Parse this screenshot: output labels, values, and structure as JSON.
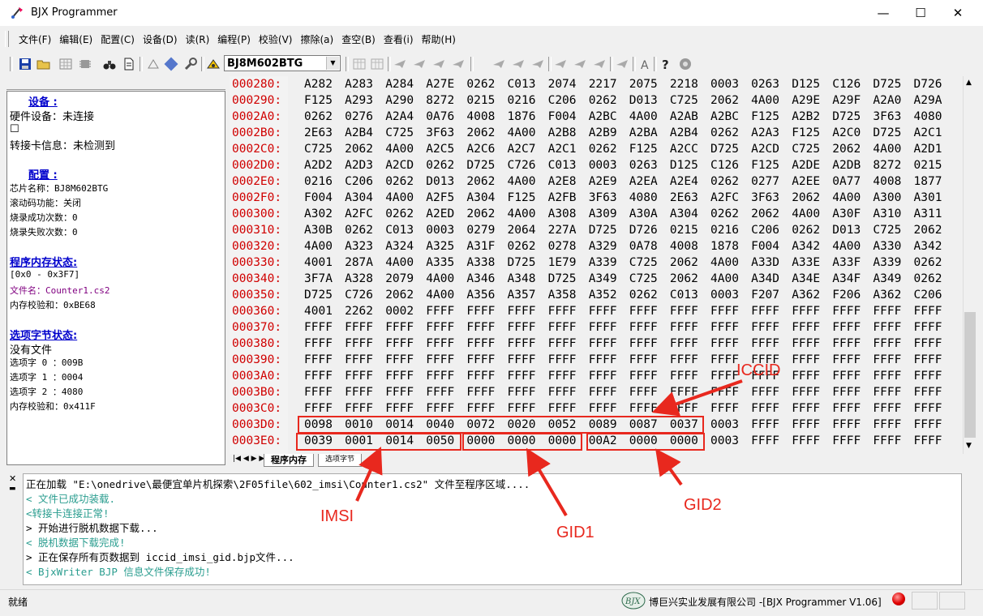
{
  "window": {
    "title": "BJX Programmer",
    "controls": {
      "minimize": "—",
      "maximize": "☐",
      "close": "✕"
    }
  },
  "menu": {
    "items": [
      "文件(F)",
      "编辑(E)",
      "配置(C)",
      "设备(D)",
      "读(R)",
      "编程(P)",
      "校验(V)",
      "擦除(a)",
      "查空(B)",
      "查看(i)",
      "帮助(H)"
    ]
  },
  "toolbar": {
    "chip_select": "BJ8M602BTG"
  },
  "left_panel": {
    "device_heading": "设备  :",
    "hardware_device": "硬件设备：未连接",
    "adapter_info": "转接卡信息：未检测到",
    "config_heading": "配置  :",
    "chip_name": "芯片名称：BJ8M602BTG",
    "rolling_code": "滚动码功能：关闭",
    "burn_success": "烧录成功次数：0",
    "burn_fail": "烧录失败次数：0",
    "memory_heading": "程序内存状态:",
    "memory_range": "[0x0 - 0x3F7]",
    "file_name_label": "文件名：",
    "file_name": "Counter1.cs2",
    "memory_checksum": "内存校验和：0xBE68",
    "option_heading": "选项字节状态:",
    "no_file": "没有文件",
    "option0": "选项字 0 ：009B",
    "option1": "选项字 1 ：0004",
    "option2": "选项字 2 ：4080",
    "option_checksum": "内存校验和：0x411F"
  },
  "hex": {
    "rows": [
      {
        "addr": "000280:",
        "words": [
          "A282",
          "A283",
          "A284",
          "A27E",
          "0262",
          "C013",
          "2074",
          "2217",
          "2075",
          "2218",
          "0003",
          "0263",
          "D125",
          "C126",
          "D725",
          "D726"
        ]
      },
      {
        "addr": "000290:",
        "words": [
          "F125",
          "A293",
          "A290",
          "8272",
          "0215",
          "0216",
          "C206",
          "0262",
          "D013",
          "C725",
          "2062",
          "4A00",
          "A29E",
          "A29F",
          "A2A0",
          "A29A"
        ]
      },
      {
        "addr": "0002A0:",
        "words": [
          "0262",
          "0276",
          "A2A4",
          "0A76",
          "4008",
          "1876",
          "F004",
          "A2BC",
          "4A00",
          "A2AB",
          "A2BC",
          "F125",
          "A2B2",
          "D725",
          "3F63",
          "4080"
        ]
      },
      {
        "addr": "0002B0:",
        "words": [
          "2E63",
          "A2B4",
          "C725",
          "3F63",
          "2062",
          "4A00",
          "A2B8",
          "A2B9",
          "A2BA",
          "A2B4",
          "0262",
          "A2A3",
          "F125",
          "A2C0",
          "D725",
          "A2C1"
        ]
      },
      {
        "addr": "0002C0:",
        "words": [
          "C725",
          "2062",
          "4A00",
          "A2C5",
          "A2C6",
          "A2C7",
          "A2C1",
          "0262",
          "F125",
          "A2CC",
          "D725",
          "A2CD",
          "C725",
          "2062",
          "4A00",
          "A2D1"
        ]
      },
      {
        "addr": "0002D0:",
        "words": [
          "A2D2",
          "A2D3",
          "A2CD",
          "0262",
          "D725",
          "C726",
          "C013",
          "0003",
          "0263",
          "D125",
          "C126",
          "F125",
          "A2DE",
          "A2DB",
          "8272",
          "0215"
        ]
      },
      {
        "addr": "0002E0:",
        "words": [
          "0216",
          "C206",
          "0262",
          "D013",
          "2062",
          "4A00",
          "A2E8",
          "A2E9",
          "A2EA",
          "A2E4",
          "0262",
          "0277",
          "A2EE",
          "0A77",
          "4008",
          "1877"
        ]
      },
      {
        "addr": "0002F0:",
        "words": [
          "F004",
          "A304",
          "4A00",
          "A2F5",
          "A304",
          "F125",
          "A2FB",
          "3F63",
          "4080",
          "2E63",
          "A2FC",
          "3F63",
          "2062",
          "4A00",
          "A300",
          "A301"
        ]
      },
      {
        "addr": "000300:",
        "words": [
          "A302",
          "A2FC",
          "0262",
          "A2ED",
          "2062",
          "4A00",
          "A308",
          "A309",
          "A30A",
          "A304",
          "0262",
          "2062",
          "4A00",
          "A30F",
          "A310",
          "A311"
        ]
      },
      {
        "addr": "000310:",
        "words": [
          "A30B",
          "0262",
          "C013",
          "0003",
          "0279",
          "2064",
          "227A",
          "D725",
          "D726",
          "0215",
          "0216",
          "C206",
          "0262",
          "D013",
          "C725",
          "2062"
        ]
      },
      {
        "addr": "000320:",
        "words": [
          "4A00",
          "A323",
          "A324",
          "A325",
          "A31F",
          "0262",
          "0278",
          "A329",
          "0A78",
          "4008",
          "1878",
          "F004",
          "A342",
          "4A00",
          "A330",
          "A342"
        ]
      },
      {
        "addr": "000330:",
        "words": [
          "4001",
          "287A",
          "4A00",
          "A335",
          "A338",
          "D725",
          "1E79",
          "A339",
          "C725",
          "2062",
          "4A00",
          "A33D",
          "A33E",
          "A33F",
          "A339",
          "0262"
        ]
      },
      {
        "addr": "000340:",
        "words": [
          "3F7A",
          "A328",
          "2079",
          "4A00",
          "A346",
          "A348",
          "D725",
          "A349",
          "C725",
          "2062",
          "4A00",
          "A34D",
          "A34E",
          "A34F",
          "A349",
          "0262"
        ]
      },
      {
        "addr": "000350:",
        "words": [
          "D725",
          "C726",
          "2062",
          "4A00",
          "A356",
          "A357",
          "A358",
          "A352",
          "0262",
          "C013",
          "0003",
          "F207",
          "A362",
          "F206",
          "A362",
          "C206"
        ]
      },
      {
        "addr": "000360:",
        "words": [
          "4001",
          "2262",
          "0002",
          "FFFF",
          "FFFF",
          "FFFF",
          "FFFF",
          "FFFF",
          "FFFF",
          "FFFF",
          "FFFF",
          "FFFF",
          "FFFF",
          "FFFF",
          "FFFF",
          "FFFF"
        ]
      },
      {
        "addr": "000370:",
        "words": [
          "FFFF",
          "FFFF",
          "FFFF",
          "FFFF",
          "FFFF",
          "FFFF",
          "FFFF",
          "FFFF",
          "FFFF",
          "FFFF",
          "FFFF",
          "FFFF",
          "FFFF",
          "FFFF",
          "FFFF",
          "FFFF"
        ]
      },
      {
        "addr": "000380:",
        "words": [
          "FFFF",
          "FFFF",
          "FFFF",
          "FFFF",
          "FFFF",
          "FFFF",
          "FFFF",
          "FFFF",
          "FFFF",
          "FFFF",
          "FFFF",
          "FFFF",
          "FFFF",
          "FFFF",
          "FFFF",
          "FFFF"
        ]
      },
      {
        "addr": "000390:",
        "words": [
          "FFFF",
          "FFFF",
          "FFFF",
          "FFFF",
          "FFFF",
          "FFFF",
          "FFFF",
          "FFFF",
          "FFFF",
          "FFFF",
          "FFFF",
          "FFFF",
          "FFFF",
          "FFFF",
          "FFFF",
          "FFFF"
        ]
      },
      {
        "addr": "0003A0:",
        "words": [
          "FFFF",
          "FFFF",
          "FFFF",
          "FFFF",
          "FFFF",
          "FFFF",
          "FFFF",
          "FFFF",
          "FFFF",
          "FFFF",
          "FFFF",
          "FFFF",
          "FFFF",
          "FFFF",
          "FFFF",
          "FFFF"
        ]
      },
      {
        "addr": "0003B0:",
        "words": [
          "FFFF",
          "FFFF",
          "FFFF",
          "FFFF",
          "FFFF",
          "FFFF",
          "FFFF",
          "FFFF",
          "FFFF",
          "FFFF",
          "FFFF",
          "FFFF",
          "FFFF",
          "FFFF",
          "FFFF",
          "FFFF"
        ]
      },
      {
        "addr": "0003C0:",
        "words": [
          "FFFF",
          "FFFF",
          "FFFF",
          "FFFF",
          "FFFF",
          "FFFF",
          "FFFF",
          "FFFF",
          "FFFF",
          "FFFF",
          "FFFF",
          "FFFF",
          "FFFF",
          "FFFF",
          "FFFF",
          "FFFF"
        ]
      },
      {
        "addr": "0003D0:",
        "words": [
          "0098",
          "0010",
          "0014",
          "0040",
          "0072",
          "0020",
          "0052",
          "0089",
          "0087",
          "0037",
          "0003",
          "FFFF",
          "FFFF",
          "FFFF",
          "FFFF",
          "FFFF"
        ]
      },
      {
        "addr": "0003E0:",
        "words": [
          "0039",
          "0001",
          "0014",
          "0050",
          "0000",
          "0000",
          "0000",
          "00A2",
          "0000",
          "0000",
          "0003",
          "FFFF",
          "FFFF",
          "FFFF",
          "FFFF",
          "FFFF"
        ]
      }
    ]
  },
  "tabs": {
    "program_memory": "程序内存",
    "option_bytes": "选项字节"
  },
  "log": {
    "lines": [
      {
        "text": "正在加载 \"E:\\onedrive\\最便宜单片机探索\\2F05file\\602_imsi\\Counter1.cs2\" 文件至程序区域....",
        "color": "#000000"
      },
      {
        "text": "< 文件已成功装载.",
        "color": "#2a9d8f"
      },
      {
        "text": "<转接卡连接正常!",
        "color": "#2a9d8f"
      },
      {
        "text": "> 开始进行脱机数据下载...",
        "color": "#000000"
      },
      {
        "text": "< 脱机数据下载完成!",
        "color": "#2a9d8f"
      },
      {
        "text": "> 正在保存所有页数据到 iccid_imsi_gid.bjp文件...",
        "color": "#000000"
      },
      {
        "text": "< BjxWriter BJP 信息文件保存成功!",
        "color": "#2a9d8f"
      }
    ]
  },
  "status": {
    "text": "就绪",
    "company": "博巨兴实业发展有限公司 -[BJX Programmer V1.06]",
    "logo": "BJX"
  },
  "annotations": {
    "iccid": "ICCID",
    "imsi": "IMSI",
    "gid1": "GID1",
    "gid2": "GID2",
    "color": "#e8281e"
  }
}
